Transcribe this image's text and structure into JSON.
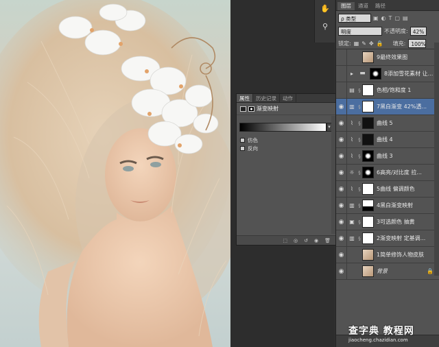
{
  "properties": {
    "tabs": [
      "属性",
      "历史记录",
      "动作"
    ],
    "title": "渐变映射",
    "opt_dither": "仿色",
    "opt_reverse": "反向"
  },
  "layers_panel": {
    "tabs": [
      "图层",
      "通道",
      "路径"
    ],
    "filter_type": "ρ 类型",
    "blend_mode": "明度",
    "opacity_label": "不透明度:",
    "opacity": "42%",
    "lock_label": "锁定:",
    "fill_label": "填充:",
    "fill": "100%",
    "items": [
      {
        "name": "9最终效果图",
        "visible": false,
        "selected": false
      },
      {
        "name": "8添加雪花素材 让...",
        "visible": false,
        "selected": false
      },
      {
        "name": "色相/饱和度 1",
        "visible": false,
        "selected": false
      },
      {
        "name": "7黑白渐变 42%透...",
        "visible": true,
        "selected": true
      },
      {
        "name": "曲线 5",
        "visible": true,
        "selected": false
      },
      {
        "name": "曲线 4",
        "visible": true,
        "selected": false
      },
      {
        "name": "曲线 3",
        "visible": true,
        "selected": false
      },
      {
        "name": "6高亮/对比度  拉...",
        "visible": true,
        "selected": false
      },
      {
        "name": "5曲线  偏调颜色",
        "visible": true,
        "selected": false
      },
      {
        "name": "4黑白渐变映射",
        "visible": true,
        "selected": false
      },
      {
        "name": "3可选颜色  抽黄",
        "visible": true,
        "selected": false
      },
      {
        "name": "2渐变映射 定基调...",
        "visible": true,
        "selected": false
      },
      {
        "name": "1简单修饰人物皮肤",
        "visible": true,
        "selected": false
      },
      {
        "name": "背景",
        "visible": true,
        "selected": false
      }
    ]
  },
  "watermark": {
    "line1": "查字典 教程网",
    "line2": "jiaocheng.chazidian.com"
  }
}
